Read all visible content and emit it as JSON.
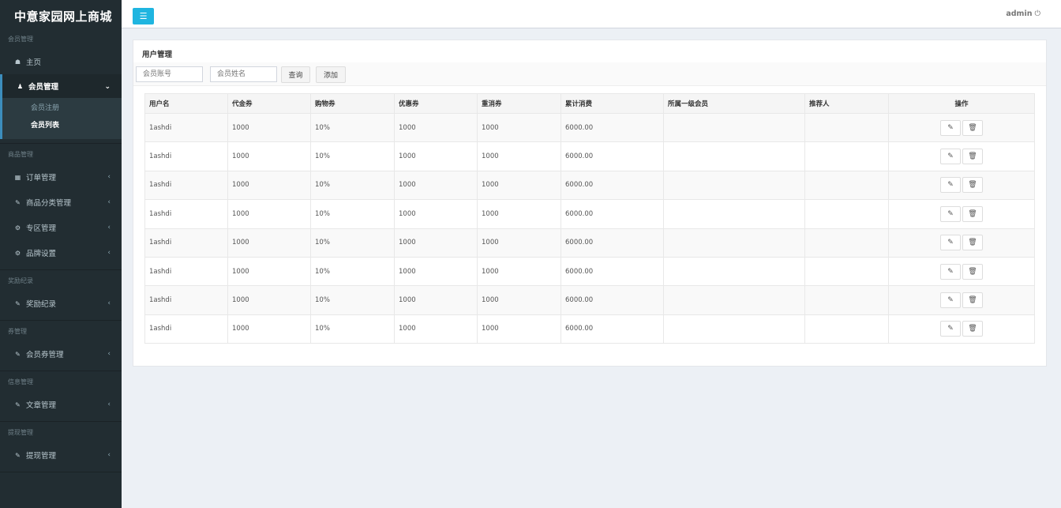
{
  "app": {
    "title": "中意家园网上商城"
  },
  "header": {
    "user": "admin",
    "toggle_icon": "menu-icon"
  },
  "sidebar": {
    "sections": [
      {
        "title": "会员管理"
      },
      {
        "title": "商品管理"
      },
      {
        "title": "奖励纪录"
      },
      {
        "title": "券管理"
      },
      {
        "title": "信息管理"
      },
      {
        "title": "提现管理"
      }
    ],
    "home": "主页",
    "member_mgmt": "会员管理",
    "member_sub": [
      "会员注册",
      "会员列表"
    ],
    "orders": "订单管理",
    "categories": "商品分类管理",
    "zones": "专区管理",
    "brands": "品牌设置",
    "rewards": "奖励纪录",
    "coupons": "会员券管理",
    "articles": "文章管理",
    "withdraw": "提现管理"
  },
  "main": {
    "title": "用户管理",
    "search_account_placeholder": "会员账号",
    "search_name_placeholder": "会员姓名",
    "query_label": "查询",
    "add_label": "添加"
  },
  "table": {
    "columns": [
      "用户名",
      "代金券",
      "购物券",
      "优惠券",
      "重消券",
      "累计消费",
      "所属一级会员",
      "推荐人",
      "操作"
    ],
    "rows": [
      [
        "1ashdi",
        "1000",
        "10%",
        "1000",
        "1000",
        "6000.00",
        "",
        ""
      ],
      [
        "1ashdi",
        "1000",
        "10%",
        "1000",
        "1000",
        "6000.00",
        "",
        ""
      ],
      [
        "1ashdi",
        "1000",
        "10%",
        "1000",
        "1000",
        "6000.00",
        "",
        ""
      ],
      [
        "1ashdi",
        "1000",
        "10%",
        "1000",
        "1000",
        "6000.00",
        "",
        ""
      ],
      [
        "1ashdi",
        "1000",
        "10%",
        "1000",
        "1000",
        "6000.00",
        "",
        ""
      ],
      [
        "1ashdi",
        "1000",
        "10%",
        "1000",
        "1000",
        "6000.00",
        "",
        ""
      ],
      [
        "1ashdi",
        "1000",
        "10%",
        "1000",
        "1000",
        "6000.00",
        "",
        ""
      ],
      [
        "1ashdi",
        "1000",
        "10%",
        "1000",
        "1000",
        "6000.00",
        "",
        ""
      ]
    ]
  },
  "colors": {
    "sidebar": "#222d32",
    "accent": "#1fb5e0",
    "active_border": "#3c8dbc"
  }
}
